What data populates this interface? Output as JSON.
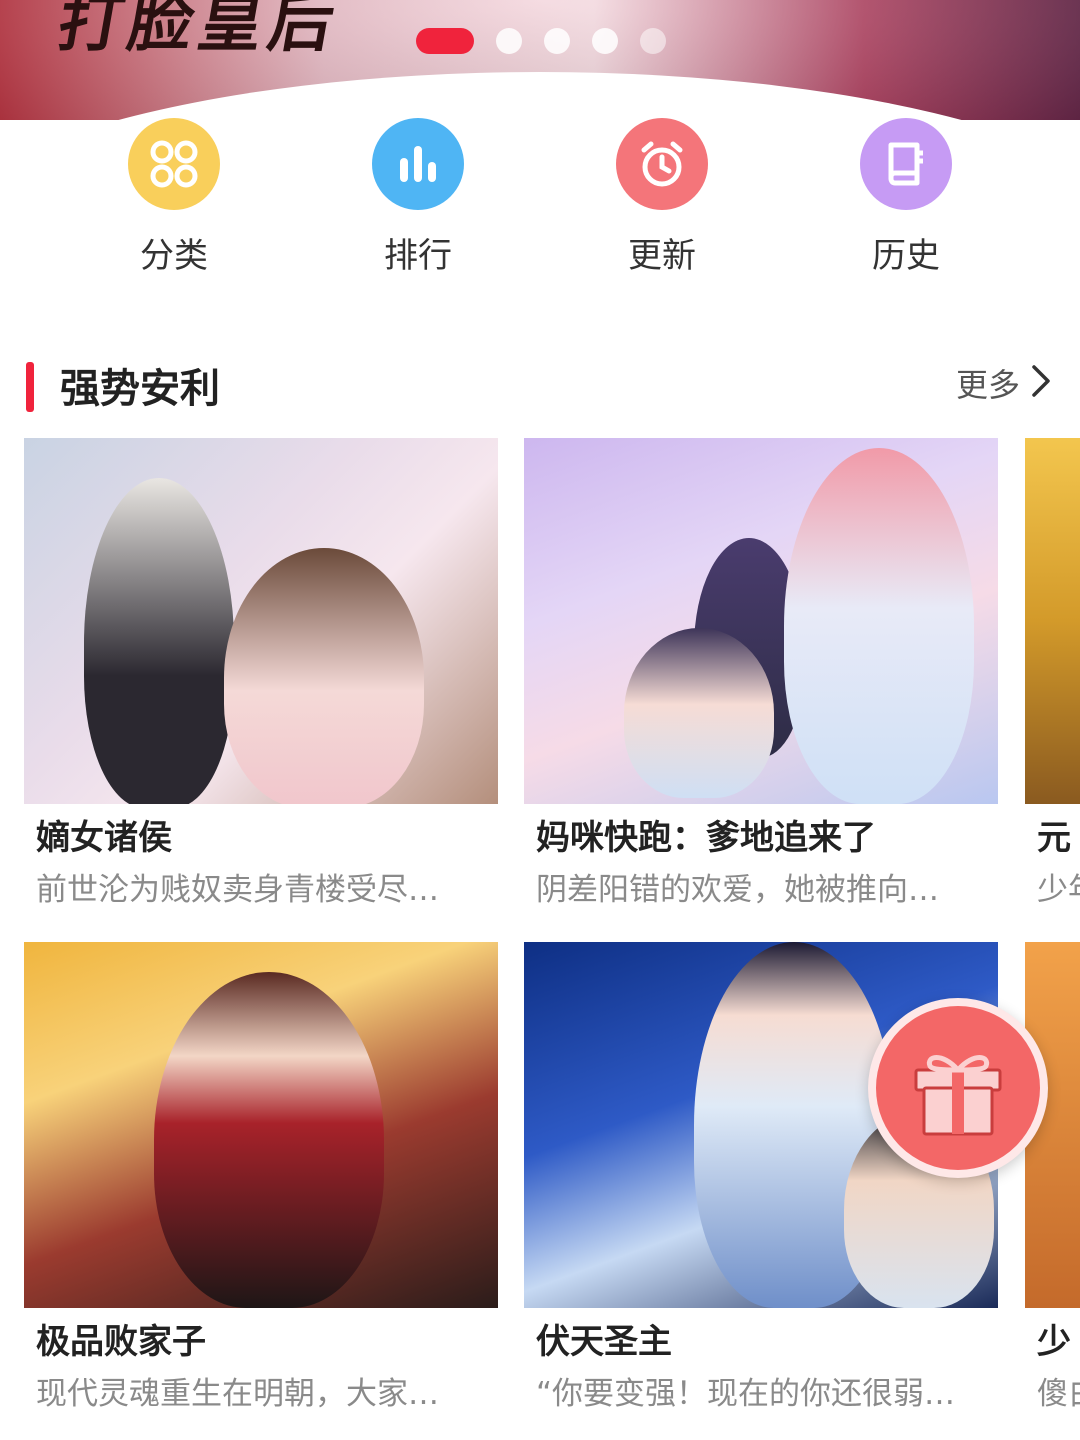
{
  "banner": {
    "title_art": "打脸皇后",
    "carousel": {
      "count": 5,
      "active_index": 0
    },
    "active_dot_color": "#f0233c"
  },
  "quick_nav": [
    {
      "label": "分类",
      "icon": "grid-icon",
      "color": "#f9cf5b"
    },
    {
      "label": "排行",
      "icon": "bar-chart-icon",
      "color": "#4fb5f4"
    },
    {
      "label": "更新",
      "icon": "alarm-clock-icon",
      "color": "#f4757a"
    },
    {
      "label": "历史",
      "icon": "book-icon",
      "color": "#c69bf4"
    }
  ],
  "section": {
    "title": "强势安利",
    "more_label": "更多",
    "accent_color": "#f0233c"
  },
  "cards": [
    {
      "title": "嫡女诸侯",
      "desc": "前世沦为贱奴卖身青楼受尽…"
    },
    {
      "title": "妈咪快跑：爹地追来了",
      "desc": "阴差阳错的欢爱，她被推向…"
    },
    {
      "title": "元",
      "desc": "少年"
    },
    {
      "title": "极品败家子",
      "desc": "现代灵魂重生在明朝，大家…"
    },
    {
      "title": "伏天圣主",
      "desc": "“你要变强！现在的你还很弱…"
    },
    {
      "title": "少",
      "desc": "傻白"
    }
  ],
  "gift_button": {
    "icon": "gift-icon",
    "color": "#f36767"
  }
}
